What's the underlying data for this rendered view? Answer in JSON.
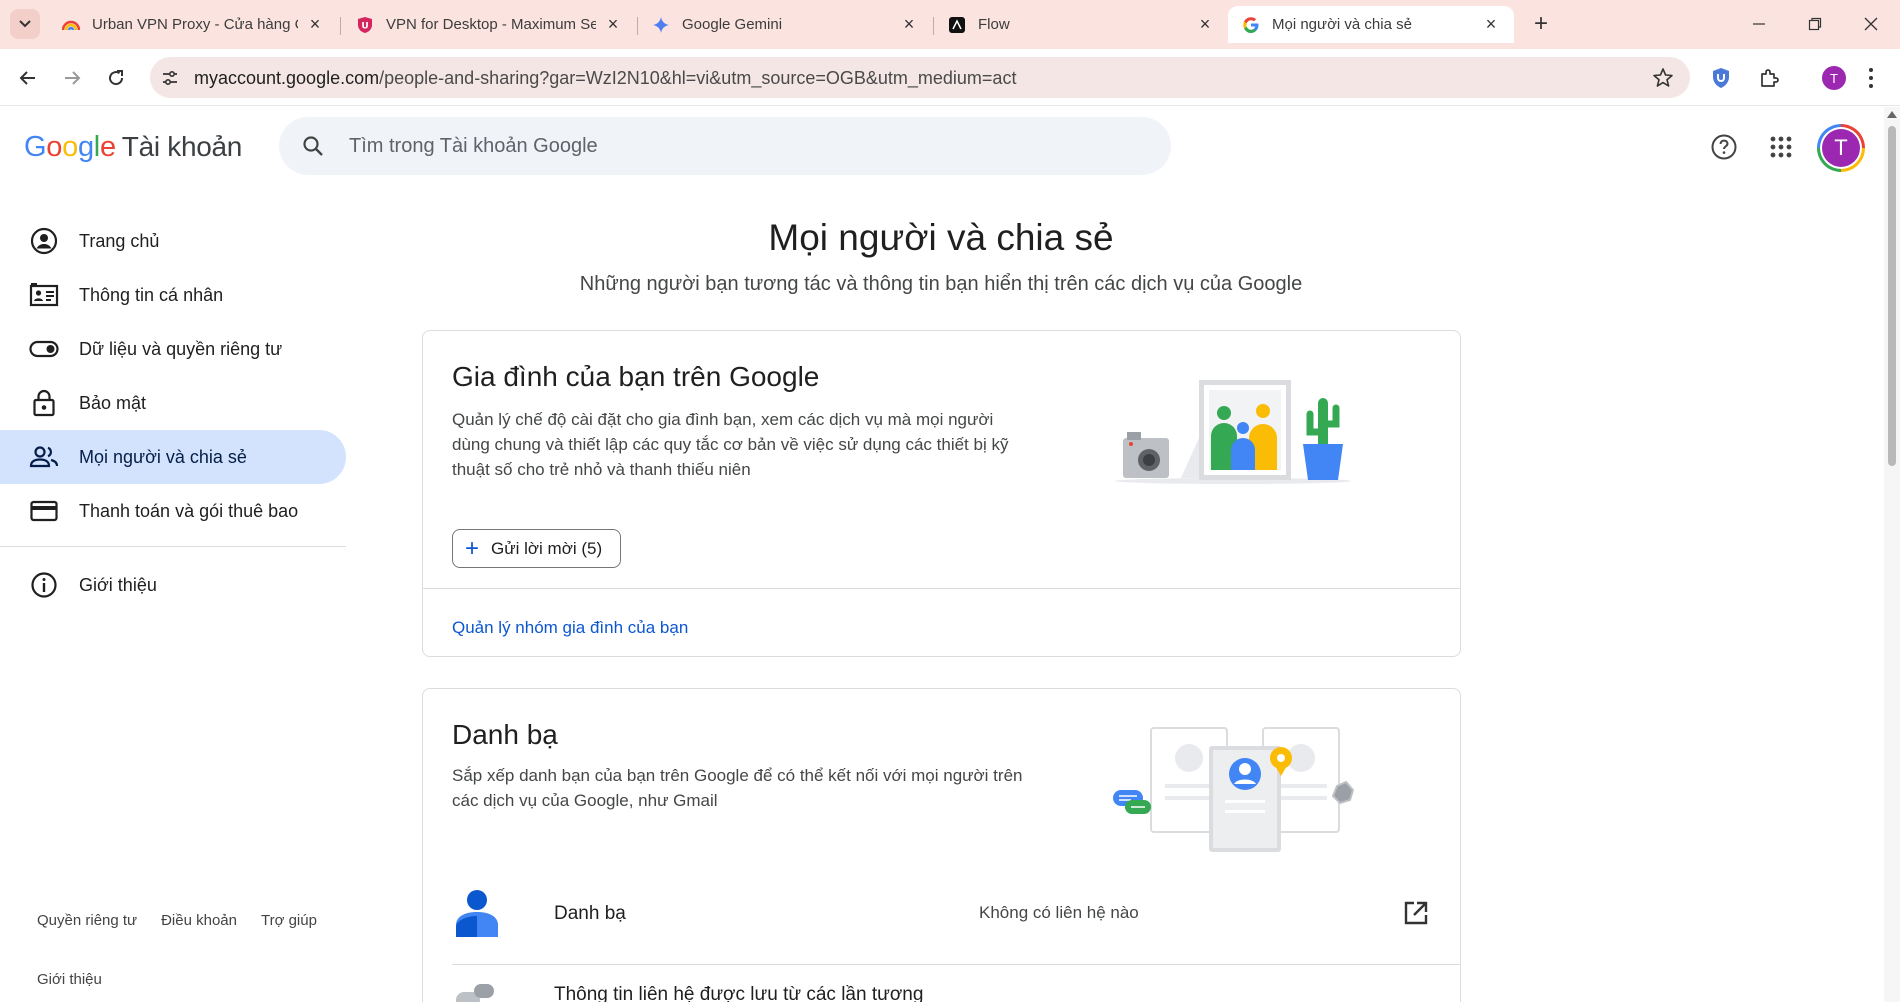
{
  "browser": {
    "tabs": [
      {
        "title": "Urban VPN Proxy - Cửa hàng Ch",
        "icon": "rainbow-icon"
      },
      {
        "title": "VPN for Desktop - Maximum Se",
        "icon": "urban-vpn-shield-icon"
      },
      {
        "title": "Google Gemini",
        "icon": "gemini-sparkle-icon"
      },
      {
        "title": "Flow",
        "icon": "flow-icon"
      },
      {
        "title": "Mọi người và chia sẻ",
        "icon": "google-g-icon",
        "active": true
      }
    ],
    "url_host": "myaccount.google.com",
    "url_path": "/people-and-sharing?gar=WzI2N10&hl=vi&utm_source=OGB&utm_medium=act",
    "profile_initial": "T"
  },
  "header": {
    "logo": {
      "g": "G",
      "o1": "o",
      "o2": "o",
      "g2": "g",
      "l": "l",
      "e": "e",
      "product": "Tài khoản"
    },
    "search_placeholder": "Tìm trong Tài khoản Google",
    "avatar_initial": "T"
  },
  "sidebar": {
    "items": [
      {
        "label": "Trang chủ",
        "icon": "account-circle-icon"
      },
      {
        "label": "Thông tin cá nhân",
        "icon": "id-card-icon"
      },
      {
        "label": "Dữ liệu và quyền riêng tư",
        "icon": "toggle-icon"
      },
      {
        "label": "Bảo mật",
        "icon": "lock-icon"
      },
      {
        "label": "Mọi người và chia sẻ",
        "icon": "people-icon",
        "active": true
      },
      {
        "label": "Thanh toán và gói thuê bao",
        "icon": "credit-card-icon"
      },
      {
        "label": "Giới thiệu",
        "icon": "info-icon"
      }
    ],
    "footer": {
      "privacy": "Quyền riêng tư",
      "terms": "Điều khoản",
      "help": "Trợ giúp",
      "about": "Giới thiệu"
    }
  },
  "main": {
    "title": "Mọi người và chia sẻ",
    "subtitle": "Những người bạn tương tác và thông tin bạn hiển thị trên các dịch vụ của Google",
    "family": {
      "title": "Gia đình của bạn trên Google",
      "description": "Quản lý chế độ cài đặt cho gia đình bạn, xem các dịch vụ mà mọi người dùng chung và thiết lập các quy tắc cơ bản về việc sử dụng các thiết bị kỹ thuật số cho trẻ nhỏ và thanh thiếu niên",
      "invite_button": "Gửi lời mời (5)",
      "manage_link": "Quản lý nhóm gia đình của bạn"
    },
    "contacts": {
      "title": "Danh bạ",
      "description": "Sắp xếp danh bạn của bạn trên Google để có thể kết nối với mọi người trên các dịch vụ của Google, như Gmail",
      "rows": [
        {
          "label": "Danh bạ",
          "value": "Không có liên hệ nào"
        },
        {
          "label": "Thông tin liên hệ được lưu từ các lần tương",
          "value": ""
        }
      ]
    }
  },
  "colors": {
    "accent": "#0b57d0",
    "active_nav": "#d3e3fd",
    "tabbar": "#fbe4e0",
    "avatar": "#9c27b0"
  }
}
